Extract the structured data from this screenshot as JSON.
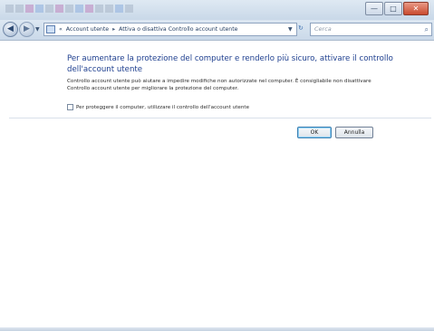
{
  "window": {
    "caption_buttons": {
      "minimize": "—",
      "maximize": "□",
      "close": "✕"
    }
  },
  "toolbar": {
    "back": "◀",
    "forward": "▶",
    "breadcrumb": [
      "Account utente",
      "Attiva o disattiva Controllo account utente"
    ],
    "breadcrumb_sep": "▸",
    "address_prefix": "«",
    "refresh": "↻",
    "search_placeholder": "Cerca"
  },
  "content": {
    "heading": "Per aumentare la protezione del computer e renderlo più sicuro, attivare il controllo dell'account utente",
    "description": "Controllo account utente può aiutare a impedire modifiche non autorizzate nel computer. È consigliabile non disattivare Controllo account utente per migliorare la protezione del computer.",
    "checkbox_label": "Per proteggere il computer, utilizzare il controllo dell'account utente",
    "checkbox_checked": false,
    "ok_label": "OK",
    "cancel_label": "Annulla"
  },
  "colors": {
    "heading": "#1e3f8f",
    "titlebar": "#c9d8e8",
    "close_button": "#c94a2e"
  },
  "icons": [
    "back-icon",
    "forward-icon",
    "control-panel-icon",
    "refresh-icon",
    "search-icon"
  ]
}
